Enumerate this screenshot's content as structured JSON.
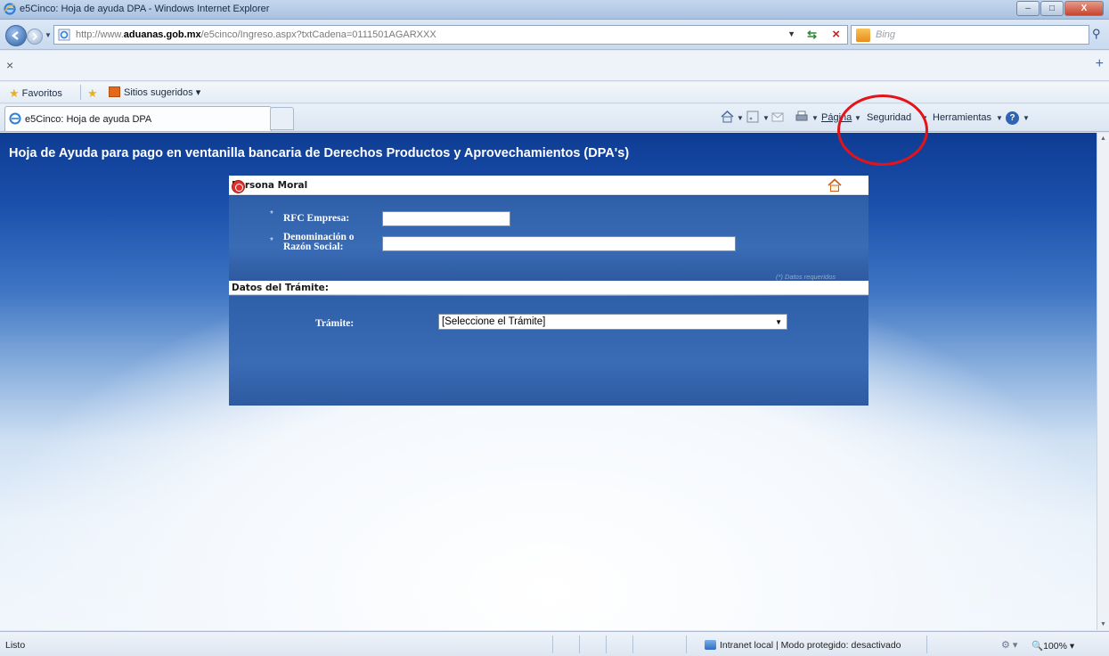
{
  "window": {
    "title": "e5Cinco: Hoja de ayuda DPA - Windows Internet Explorer",
    "buttons": {
      "minimize": "–",
      "maximize": "□",
      "close": "X"
    }
  },
  "address_bar": {
    "url_prefix": "http://www.",
    "url_domain": "aduanas.gob.mx",
    "url_path": "/e5cinco/Ingreso.aspx?txtCadena=0111501AGARXXX",
    "search_placeholder": "Bing"
  },
  "find_bar": {
    "close": "×",
    "add": "+"
  },
  "favorites_bar": {
    "favorites_label": "Favoritos",
    "suggested_sites_label": "Sitios sugeridos ▾"
  },
  "tab": {
    "label": "e5Cinco: Hoja de ayuda DPA"
  },
  "command_bar": {
    "page_label": "Página",
    "security_label": "Seguridad",
    "tools_label": "Herramientas"
  },
  "page": {
    "heading": "Hoja de Ayuda para pago en ventanilla bancaria de Derechos Productos y Aprovechamientos (DPA's)",
    "section_persona": {
      "title": "Persona Moral",
      "fields": [
        {
          "label": "RFC Empresa:",
          "value": "",
          "required_mark": "*"
        },
        {
          "label_line1": "Denominación o",
          "label_line2": "Razón Social:",
          "value": "",
          "required_mark": "*"
        }
      ],
      "required_note": "(*) Datos requeridos"
    },
    "section_tramite": {
      "title": "Datos del Trámite:",
      "field_label": "Trámite:",
      "selected_option": "[Seleccione el Trámite]"
    }
  },
  "status_bar": {
    "status": "Listo",
    "zone": "Intranet local | Modo protegido: desactivado",
    "zoom": "100%"
  },
  "annotation": {
    "color": "#e21419"
  }
}
